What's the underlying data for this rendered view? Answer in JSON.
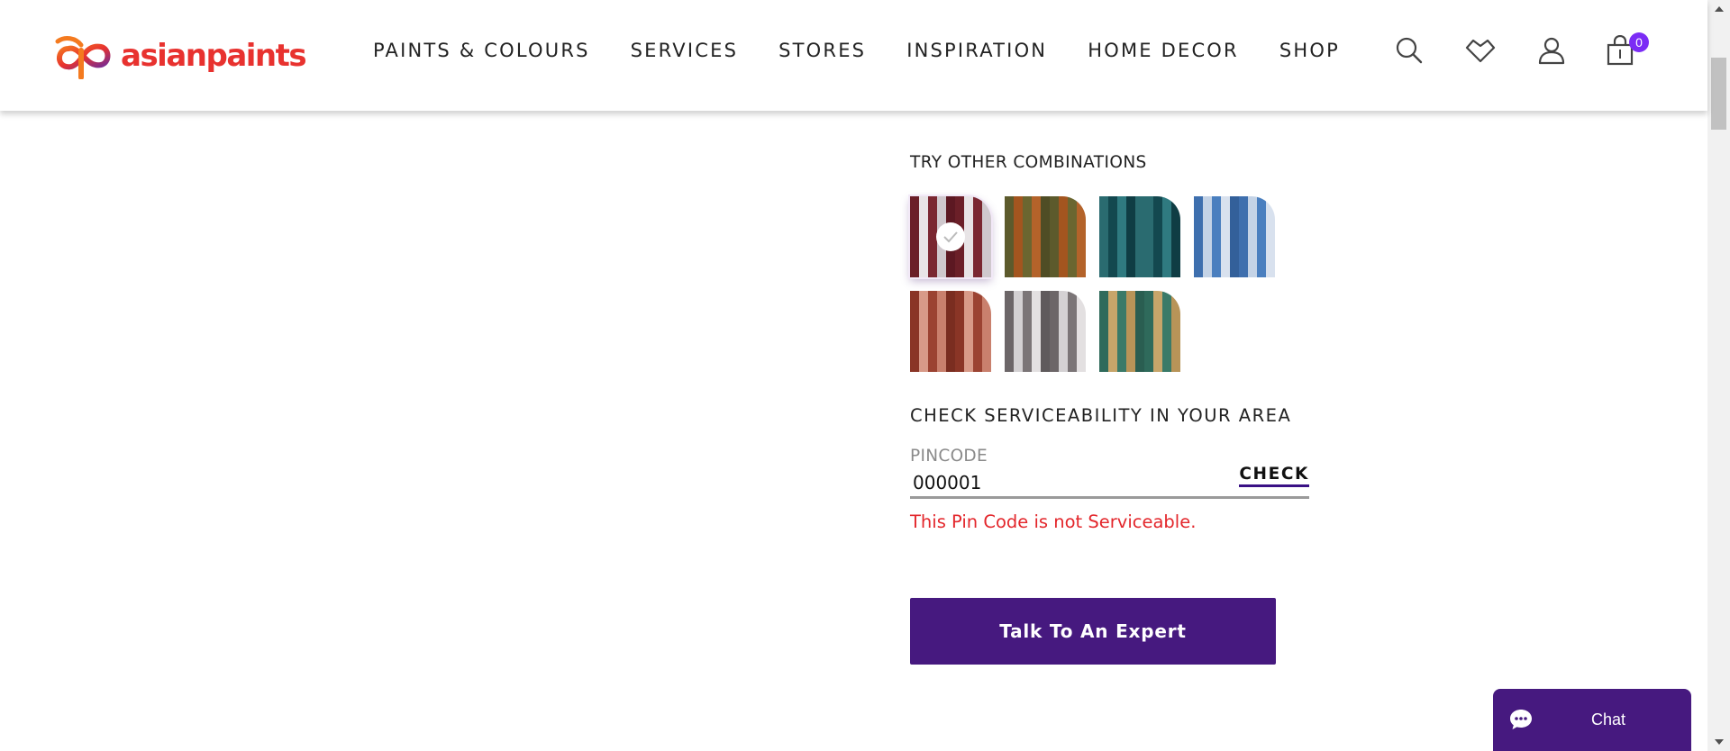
{
  "brand": {
    "logo_text": "asianpaints",
    "logo_icon": "asianpaints-logo-icon",
    "colors": {
      "logo_red": "#e8322f",
      "logo_orange": "#f47a1f",
      "logo_purple": "#6e2b9c"
    }
  },
  "nav": {
    "items": [
      {
        "label": "PAINTS & COLOURS"
      },
      {
        "label": "SERVICES"
      },
      {
        "label": "STORES"
      },
      {
        "label": "INSPIRATION"
      },
      {
        "label": "HOME DECOR"
      },
      {
        "label": "SHOP"
      }
    ]
  },
  "header_icons": {
    "search": "search-icon",
    "wishlist": "heart-icon",
    "account": "user-icon",
    "cart": "cart-icon",
    "cart_count": "0"
  },
  "combinations": {
    "title": "TRY OTHER COMBINATIONS",
    "swatches": [
      {
        "name": "maroon-white-stripe",
        "selected": true,
        "colors": [
          "#6b1f28",
          "#e8e4e6",
          "#7a2731",
          "#cfc8cd",
          "#5c1822"
        ]
      },
      {
        "name": "olive-orange-stripe",
        "selected": false,
        "colors": [
          "#5c5a2c",
          "#a3551f",
          "#6b6630",
          "#b4632a",
          "#4f4d25"
        ]
      },
      {
        "name": "teal-stripe",
        "selected": false,
        "colors": [
          "#2a6b70",
          "#13484f",
          "#2f7a80",
          "#0f3d44",
          "#2a6b70"
        ]
      },
      {
        "name": "blue-white-stripe",
        "selected": false,
        "colors": [
          "#3e6fae",
          "#c4d3e6",
          "#4a7fbf",
          "#d8e1ee",
          "#33609a"
        ]
      },
      {
        "name": "rust-peach-stripe",
        "selected": false,
        "colors": [
          "#8a3526",
          "#d89a88",
          "#9b4332",
          "#c9806d",
          "#7a2d20"
        ]
      },
      {
        "name": "grey-white-stripe",
        "selected": false,
        "colors": [
          "#6c6668",
          "#d4d1d3",
          "#7b7577",
          "#e3e0e1",
          "#5f5a5c"
        ]
      },
      {
        "name": "green-gold-stripe",
        "selected": false,
        "colors": [
          "#2f6a5b",
          "#c7a56a",
          "#3a7a68",
          "#b89458",
          "#2a5e51"
        ]
      }
    ]
  },
  "serviceability": {
    "title": "CHECK SERVICEABILITY IN YOUR AREA",
    "pincode_label": "PINCODE",
    "pincode_value": "000001",
    "check_label": "CHECK",
    "error_message": "This Pin Code is not Serviceable."
  },
  "cta": {
    "expert_label": "Talk To An Expert",
    "color": "#46197f"
  },
  "chat": {
    "label": "Chat",
    "icon": "chat-bubble-icon"
  }
}
